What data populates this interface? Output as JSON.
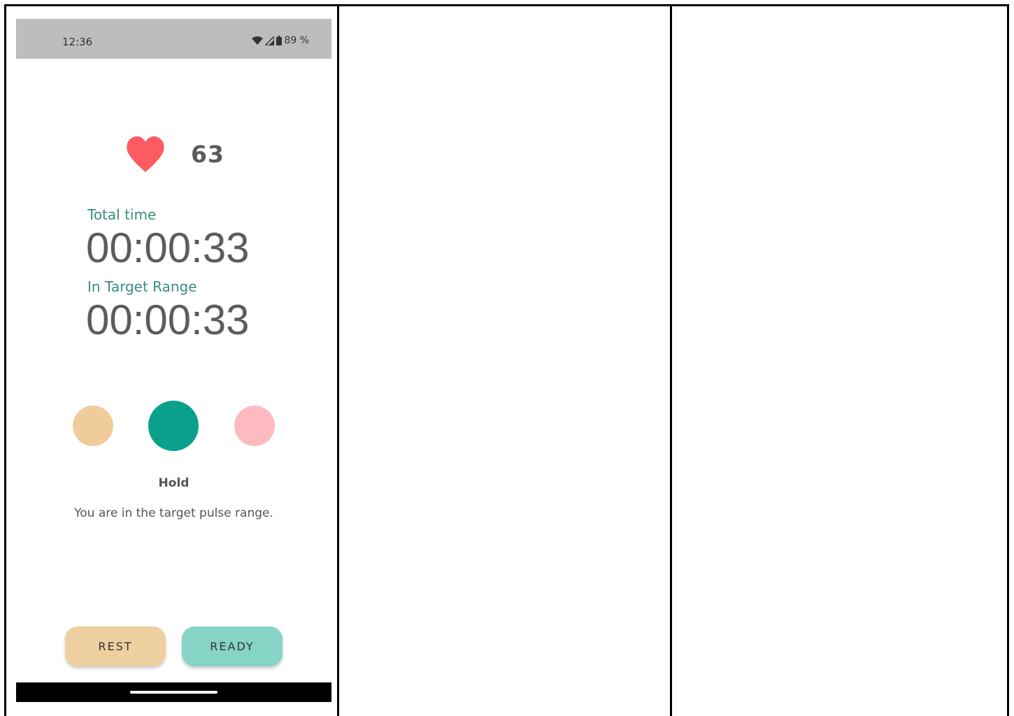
{
  "status_bar": {
    "time": "12:36",
    "battery": "89 %",
    "icons": [
      "wifi-icon",
      "signal-icon",
      "battery-icon"
    ]
  },
  "heart_rate": {
    "icon": "heart-icon",
    "value": "63",
    "color": "#fd5b64"
  },
  "total_time": {
    "label": "Total time",
    "value": "00:00:33"
  },
  "in_target": {
    "label": "In Target Range",
    "value": "00:00:33"
  },
  "indicators": {
    "colors": {
      "rest": "#f0cc9a",
      "hold": "#0aa18c",
      "high": "#fdbbbf"
    },
    "active": "hold"
  },
  "state": {
    "label": "Hold",
    "description": "You are in the target pulse range."
  },
  "buttons": {
    "rest_label": "REST",
    "ready_label": "READY"
  },
  "colors": {
    "accent_teal": "#3c8c82",
    "status_bar_bg": "#bdbdbd"
  }
}
